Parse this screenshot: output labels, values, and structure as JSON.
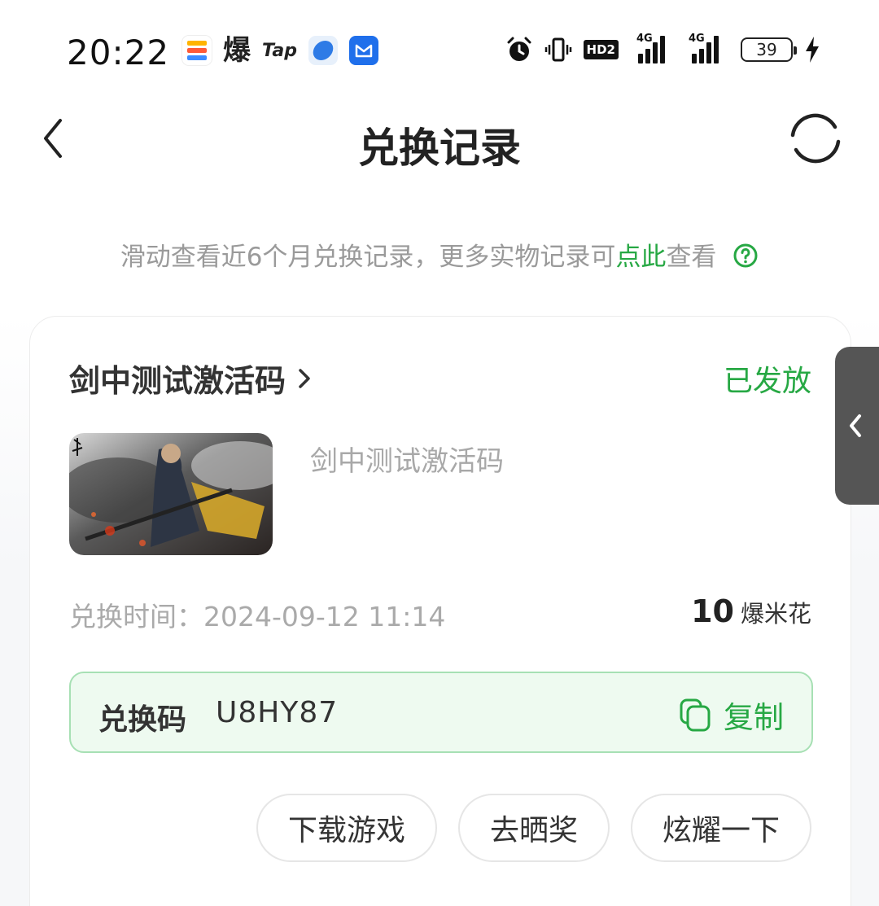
{
  "status_bar": {
    "time": "20:22",
    "bao_glyph": "爆",
    "tap_label": "Tap",
    "hd_label": "HD2",
    "net1": "4G",
    "net2": "4G",
    "battery": "39"
  },
  "header": {
    "title": "兑换记录",
    "back_icon": "chevron-left-icon",
    "refresh_icon": "refresh-icon"
  },
  "notice": {
    "text_before": "滑动查看近6个月兑换记录，更多实物记录可",
    "link_text": "点此",
    "text_after": "查看"
  },
  "record": {
    "title": "剑中测试激活码",
    "status": "已发放",
    "item_name": "剑中测试激活码",
    "time_text": "兑换时间：2024-09-12 11:14",
    "price": "10",
    "price_unit": "爆米花",
    "code_label": "兑换码",
    "code_value": "U8HY87",
    "copy_label": "复制"
  },
  "actions": {
    "download": "下载游戏",
    "show": "去晒奖",
    "brag": "炫耀一下"
  },
  "colors": {
    "accent_green": "#27a844",
    "code_bg": "#eefaf0",
    "code_border": "#a7e0b4"
  }
}
